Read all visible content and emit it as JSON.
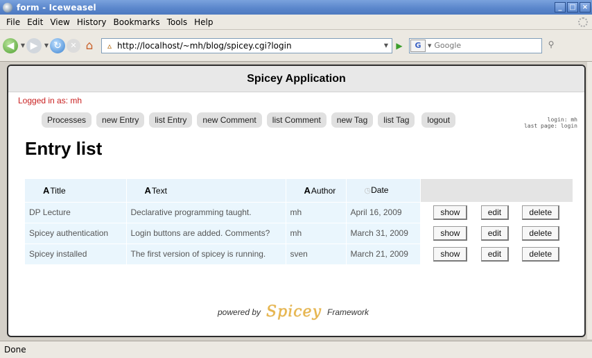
{
  "window": {
    "title": "form - Iceweasel"
  },
  "menu": [
    "File",
    "Edit",
    "View",
    "History",
    "Bookmarks",
    "Tools",
    "Help"
  ],
  "toolbar": {
    "url": "http://localhost/~mh/blog/spicey.cgi?login",
    "search_placeholder": "Google",
    "search_engine": "G"
  },
  "app": {
    "header": "Spicey Application",
    "logged_in": "Logged in as: mh",
    "nav": [
      "Processes",
      "new Entry",
      "list Entry",
      "new Comment",
      "list Comment",
      "new Tag",
      "list Tag",
      "logout"
    ],
    "login_info": [
      "login: mh",
      "last page: login"
    ],
    "page_title": "Entry list",
    "table": {
      "headers": [
        "Title",
        "Text",
        "Author",
        "Date"
      ],
      "rows": [
        {
          "title": "DP Lecture",
          "text": "Declarative programming taught.",
          "author": "mh",
          "date": "April 16, 2009"
        },
        {
          "title": "Spicey authentication",
          "text": "Login buttons are added. Comments?",
          "author": "mh",
          "date": "March 31, 2009"
        },
        {
          "title": "Spicey installed",
          "text": "The first version of spicey is running.",
          "author": "sven",
          "date": "March 21, 2009"
        }
      ],
      "actions": {
        "show": "show",
        "edit": "edit",
        "delete": "delete"
      }
    },
    "footer": {
      "prefix": "powered by",
      "logo": "Spicey",
      "suffix": "Framework"
    }
  },
  "status": "Done",
  "colors": {
    "logged_in": "#c81e1e",
    "table_bg": "#eaf6fd",
    "titlebar": "#5b87cc"
  }
}
